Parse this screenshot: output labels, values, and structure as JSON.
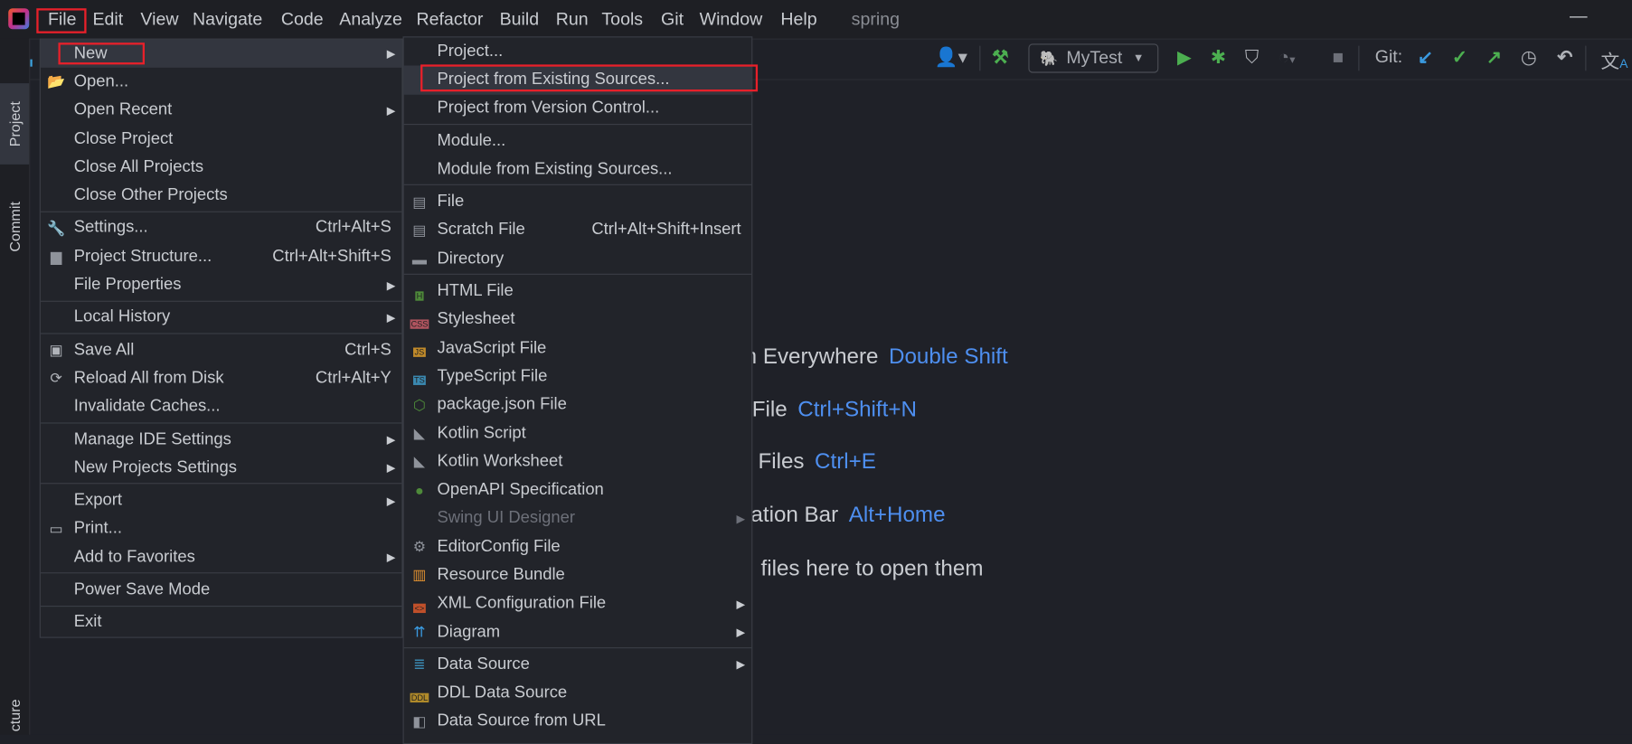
{
  "menubar": {
    "items": [
      "File",
      "Edit",
      "View",
      "Navigate",
      "Code",
      "Analyze",
      "Refactor",
      "Build",
      "Run",
      "Tools",
      "Git",
      "Window",
      "Help"
    ],
    "project_name": "spring",
    "minimize": "—"
  },
  "toolbar": {
    "run_config": "MyTest",
    "git_label": "Git:"
  },
  "left_tabs": {
    "project": "Project",
    "commit": "Commit",
    "structure": "cture"
  },
  "file_menu": [
    {
      "label": "New",
      "icon": "",
      "arrow": true,
      "selected": true
    },
    {
      "label": "Open...",
      "icon": "folder-open-icon"
    },
    {
      "label": "Open Recent",
      "arrow": true
    },
    {
      "label": "Close Project"
    },
    {
      "label": "Close All Projects"
    },
    {
      "label": "Close Other Projects"
    },
    {
      "sep": true
    },
    {
      "label": "Settings...",
      "icon": "wrench-icon",
      "shortcut": "Ctrl+Alt+S"
    },
    {
      "label": "Project Structure...",
      "icon": "project-structure-icon",
      "shortcut": "Ctrl+Alt+Shift+S"
    },
    {
      "label": "File Properties",
      "arrow": true
    },
    {
      "sep": true
    },
    {
      "label": "Local History",
      "arrow": true
    },
    {
      "sep": true
    },
    {
      "label": "Save All",
      "icon": "save-icon",
      "shortcut": "Ctrl+S"
    },
    {
      "label": "Reload All from Disk",
      "icon": "reload-icon",
      "shortcut": "Ctrl+Alt+Y"
    },
    {
      "label": "Invalidate Caches..."
    },
    {
      "sep": true
    },
    {
      "label": "Manage IDE Settings",
      "arrow": true
    },
    {
      "label": "New Projects Settings",
      "arrow": true
    },
    {
      "sep": true
    },
    {
      "label": "Export",
      "arrow": true
    },
    {
      "label": "Print...",
      "icon": "print-icon"
    },
    {
      "label": "Add to Favorites",
      "arrow": true
    },
    {
      "sep": true
    },
    {
      "label": "Power Save Mode"
    },
    {
      "sep": true
    },
    {
      "label": "Exit"
    }
  ],
  "new_submenu": [
    {
      "label": "Project..."
    },
    {
      "label": "Project from Existing Sources...",
      "selected": true
    },
    {
      "label": "Project from Version Control..."
    },
    {
      "sep": true
    },
    {
      "label": "Module..."
    },
    {
      "label": "Module from Existing Sources..."
    },
    {
      "sep": true
    },
    {
      "label": "File",
      "icon": "file-icon"
    },
    {
      "label": "Scratch File",
      "icon": "scratch-file-icon",
      "shortcut": "Ctrl+Alt+Shift+Insert"
    },
    {
      "label": "Directory",
      "icon": "directory-icon"
    },
    {
      "sep": true
    },
    {
      "label": "HTML File",
      "icon": "html-file-icon",
      "badge": "H",
      "color": "#4e8a3a"
    },
    {
      "label": "Stylesheet",
      "icon": "css-file-icon",
      "badge": "CSS",
      "color": "#b0545f"
    },
    {
      "label": "JavaScript File",
      "icon": "js-file-icon",
      "badge": "JS",
      "color": "#c08a2a"
    },
    {
      "label": "TypeScript File",
      "icon": "ts-file-icon",
      "badge": "TS",
      "color": "#3a88b0"
    },
    {
      "label": "package.json File",
      "icon": "nodejs-icon"
    },
    {
      "label": "Kotlin Script",
      "icon": "kotlin-script-icon"
    },
    {
      "label": "Kotlin Worksheet",
      "icon": "kotlin-worksheet-icon"
    },
    {
      "label": "OpenAPI Specification",
      "icon": "openapi-icon"
    },
    {
      "label": "Swing UI Designer",
      "arrow": true,
      "disabled": true
    },
    {
      "label": "EditorConfig File",
      "icon": "gear-icon"
    },
    {
      "label": "Resource Bundle",
      "icon": "resource-bundle-icon"
    },
    {
      "label": "XML Configuration File",
      "icon": "xml-file-icon",
      "badge": "<>",
      "color": "#c0502a",
      "arrow": true
    },
    {
      "label": "Diagram",
      "icon": "diagram-icon",
      "arrow": true
    },
    {
      "sep": true
    },
    {
      "label": "Data Source",
      "icon": "database-icon",
      "arrow": true
    },
    {
      "label": "DDL Data Source",
      "icon": "ddl-icon",
      "badge": "DDL",
      "color": "#b08a2a"
    },
    {
      "label": "Data Source from URL",
      "icon": "plug-icon"
    }
  ],
  "welcome_hints": [
    {
      "text": "ch Everywhere",
      "key": "Double Shift"
    },
    {
      "text": "o File",
      "key": "Ctrl+Shift+N"
    },
    {
      "text": "nt Files",
      "key": "Ctrl+E"
    },
    {
      "text": "igation Bar",
      "key": "Alt+Home"
    },
    {
      "text": "files here to open them",
      "key": ""
    }
  ],
  "colors": {
    "accent": "#4e8ff0",
    "highlight_box": "#e8202a",
    "run_green": "#4caf50"
  }
}
